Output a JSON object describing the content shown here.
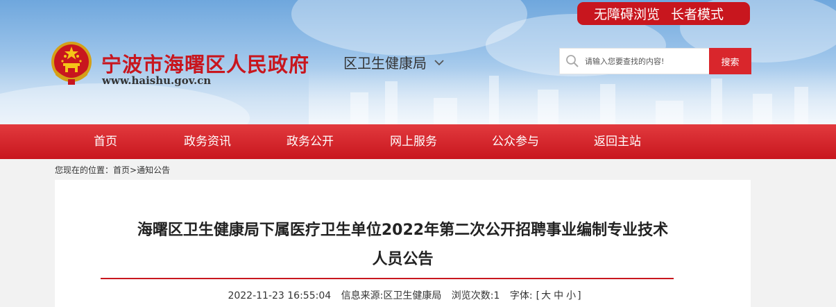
{
  "accessibility": {
    "barrier_free": "无障碍浏览",
    "elder_mode": "长者模式"
  },
  "site": {
    "name": "宁波市海曙区人民政府",
    "url": "www.haishu.gov.cn"
  },
  "department": {
    "name": "区卫生健康局"
  },
  "search": {
    "placeholder": "请输入您要查找的内容!",
    "button": "搜索"
  },
  "nav": {
    "items": [
      "首页",
      "政务资讯",
      "政务公开",
      "网上服务",
      "公众参与",
      "返回主站"
    ]
  },
  "breadcrumb": {
    "prefix": "您现在的位置：",
    "home": "首页",
    "sep": ">",
    "current": "通知公告"
  },
  "article": {
    "title": "海曙区卫生健康局下属医疗卫生单位2022年第二次公开招聘事业编制专业技术人员公告",
    "date": "2022-11-23 16:55:04",
    "source_label": "信息来源:",
    "source": "区卫生健康局",
    "views_label": "浏览次数:",
    "views": "1",
    "font_label": "字体:",
    "font_open": "[",
    "font_large": "大",
    "font_medium": "中",
    "font_small": "小",
    "font_close": "]"
  },
  "colors": {
    "brand_red": "#c8161e",
    "banner_blue": "#6fa7dd"
  }
}
